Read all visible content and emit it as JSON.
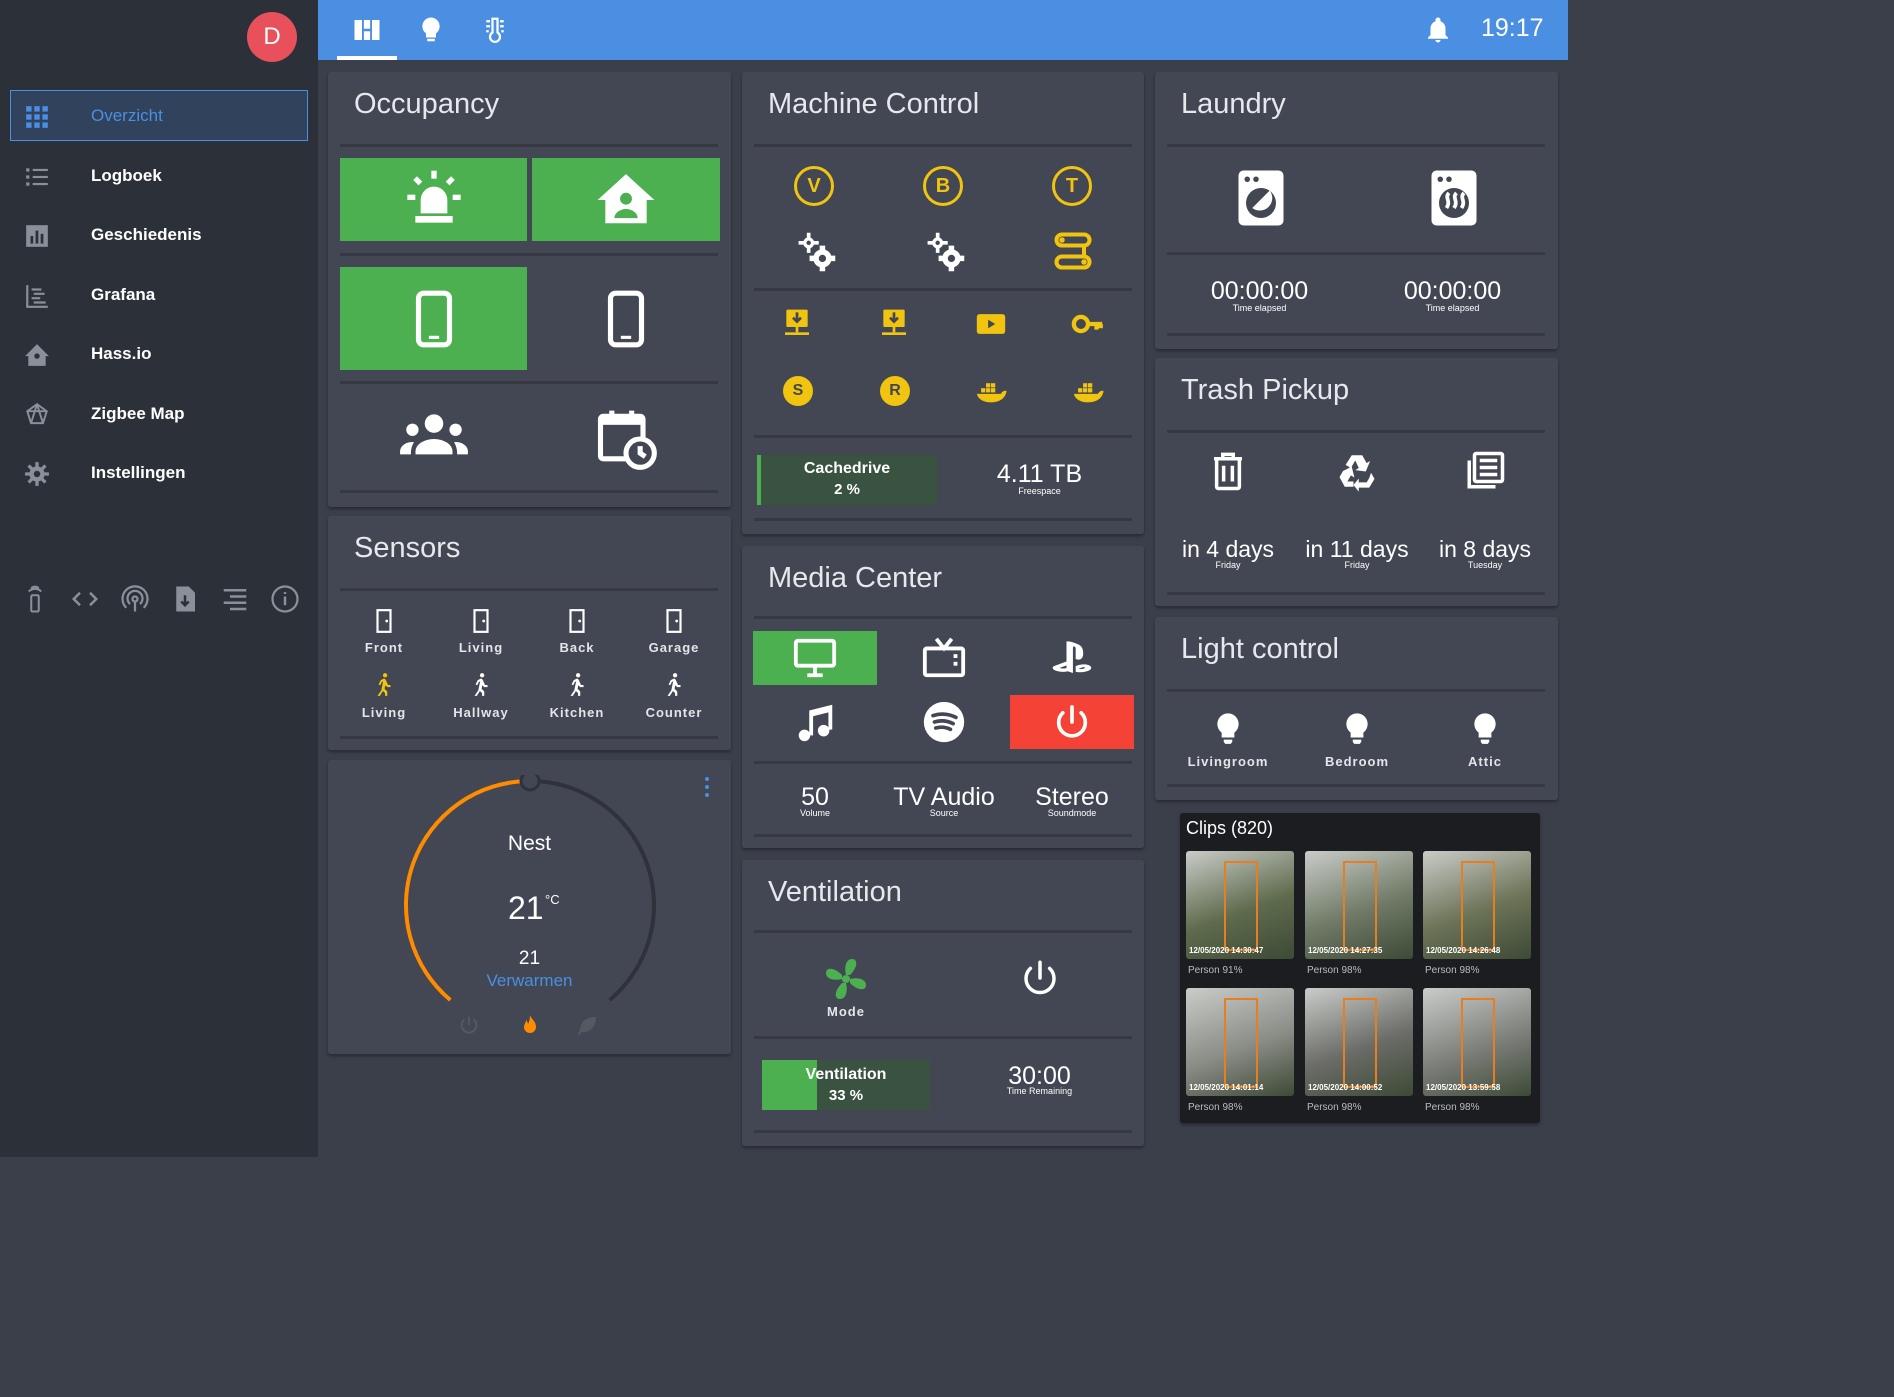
{
  "sidebar": {
    "avatar": "D",
    "items": [
      {
        "label": "Overzicht"
      },
      {
        "label": "Logboek"
      },
      {
        "label": "Geschiedenis"
      },
      {
        "label": "Grafana"
      },
      {
        "label": "Hass.io"
      },
      {
        "label": "Zigbee Map"
      },
      {
        "label": "Instellingen"
      }
    ]
  },
  "topbar": {
    "time": "19:17"
  },
  "occupancy": {
    "title": "Occupancy"
  },
  "sensors": {
    "title": "Sensors",
    "doors": [
      "Front",
      "Living",
      "Back",
      "Garage"
    ],
    "motion": [
      "Living",
      "Hallway",
      "Kitchen",
      "Counter"
    ]
  },
  "thermostat": {
    "name": "Nest",
    "temp": "21",
    "unit": "°C",
    "target": "21",
    "mode": "Verwarmen",
    "progress": 0.5
  },
  "machine": {
    "title": "Machine Control",
    "letters": [
      "V",
      "B",
      "T"
    ],
    "coins": [
      "S",
      "R"
    ],
    "cache_label": "Cachedrive",
    "cache_value": "2 %",
    "cache_fill": 0.02,
    "free_value": "4.11 TB",
    "free_label": "Freespace"
  },
  "media": {
    "title": "Media Center",
    "volume": "50",
    "volume_label": "Volume",
    "source": "TV Audio",
    "source_label": "Source",
    "soundmode": "Stereo",
    "soundmode_label": "Soundmode"
  },
  "ventilation": {
    "title": "Ventilation",
    "mode_label": "Mode",
    "bar_label": "Ventilation",
    "bar_value": "33 %",
    "bar_fill": 0.33,
    "timer": "30:00",
    "timer_label": "Time Remaining"
  },
  "laundry": {
    "title": "Laundry",
    "washer_time": "00:00:00",
    "washer_label": "Time elapsed",
    "dryer_time": "00:00:00",
    "dryer_label": "Time elapsed"
  },
  "trash": {
    "title": "Trash Pickup",
    "items": [
      {
        "when": "in 4 days",
        "day": "Friday"
      },
      {
        "when": "in 11 days",
        "day": "Friday"
      },
      {
        "when": "in 8 days",
        "day": "Tuesday"
      }
    ]
  },
  "light": {
    "title": "Light control",
    "items": [
      "Livingroom",
      "Bedroom",
      "Attic"
    ]
  },
  "clips": {
    "title": "Clips (820)",
    "items": [
      {
        "caption": "Person 91%",
        "stamp": "12/05/2020 14:30:47"
      },
      {
        "caption": "Person 98%",
        "stamp": "12/05/2020 14:27:35"
      },
      {
        "caption": "Person 98%",
        "stamp": "12/05/2020 14:26:48"
      },
      {
        "caption": "Person 98%",
        "stamp": "12/05/2020 14:01:14"
      },
      {
        "caption": "Person 98%",
        "stamp": "12/05/2020 14:00:52"
      },
      {
        "caption": "Person 98%",
        "stamp": "12/05/2020 13:59:58"
      }
    ]
  },
  "colors": {
    "accent": "#4a8fe2",
    "green": "#4caf50",
    "yellow": "#f1c40f",
    "red": "#f44336",
    "orange": "#ff8c00"
  }
}
